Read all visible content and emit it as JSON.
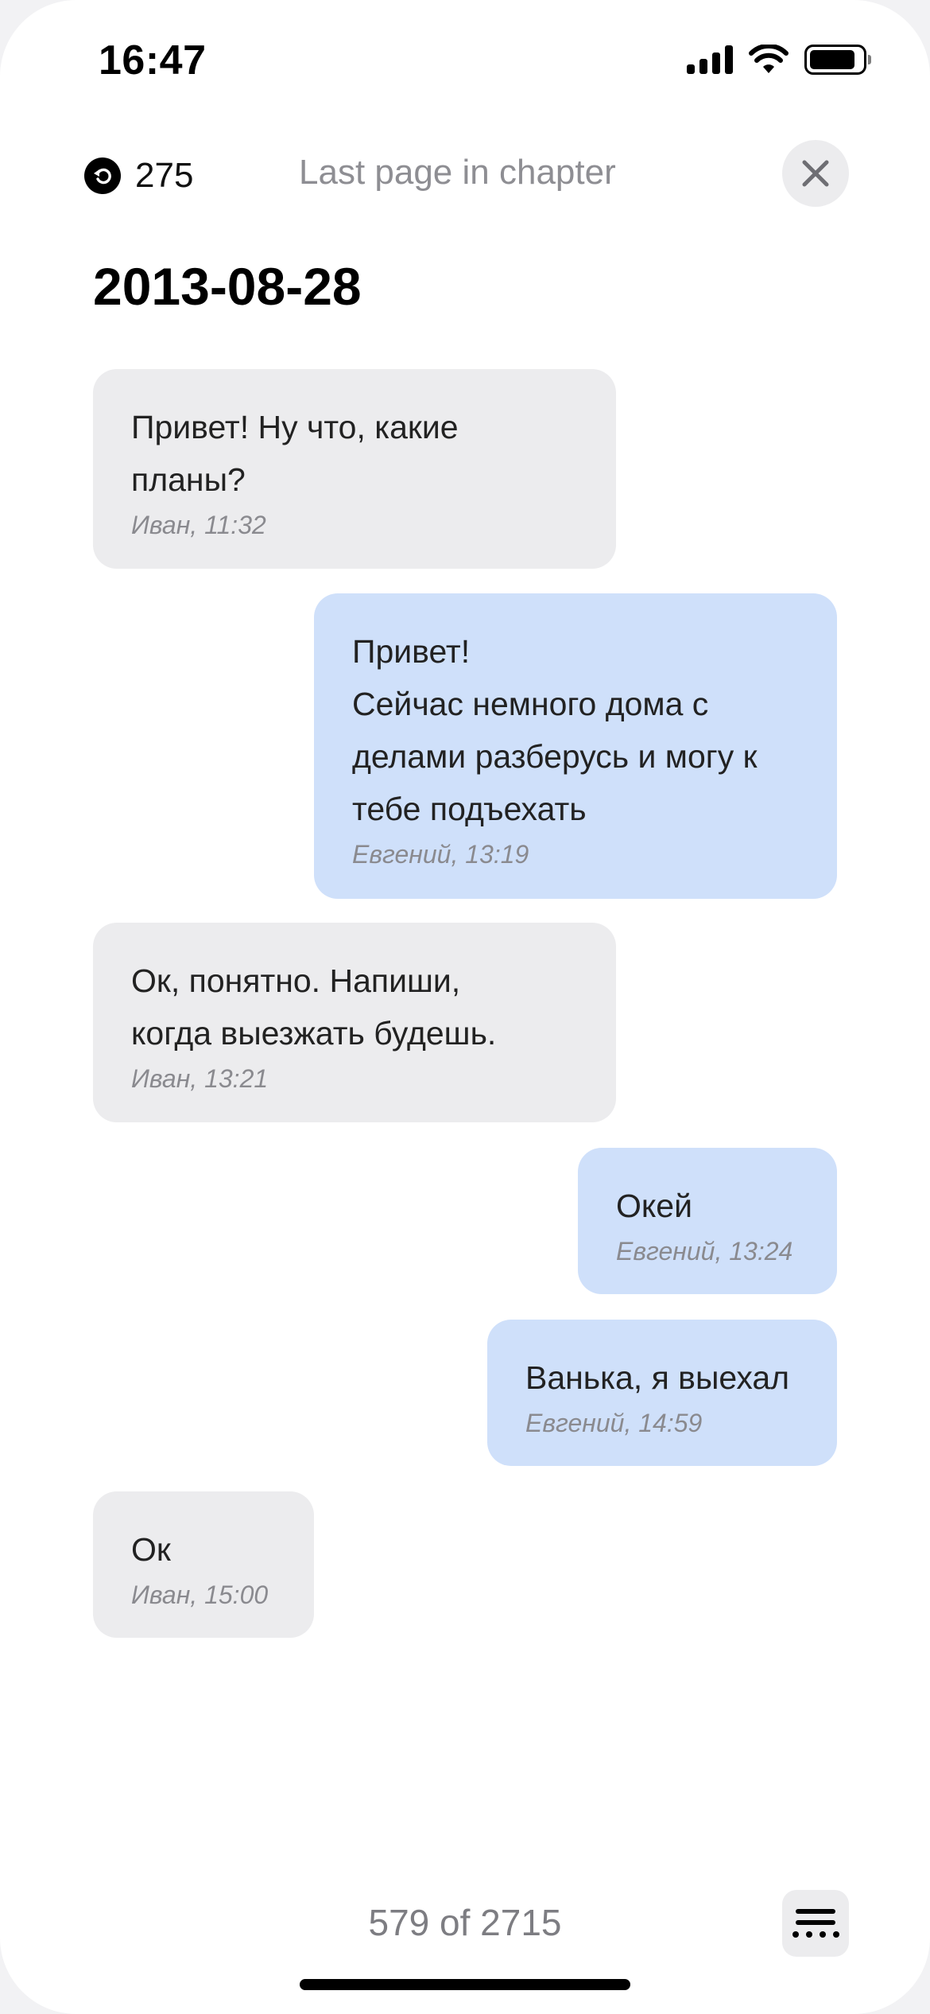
{
  "status_bar": {
    "time": "16:47"
  },
  "header": {
    "back_count": "275",
    "title": "Last page in chapter"
  },
  "date_heading": "2013-08-28",
  "messages": [
    {
      "direction": "in",
      "text": "Привет! Ну что, какие\nпланы?",
      "meta": "Иван, 11:32"
    },
    {
      "direction": "out",
      "text": "Привет!\nСейчас немного дома с\nделами разберусь и могу к\nтебе подъехать",
      "meta": "Евгений, 13:19"
    },
    {
      "direction": "in",
      "text": "Ок, понятно. Напиши,\nкогда выезжать будешь.",
      "meta": "Иван, 13:21"
    },
    {
      "direction": "out",
      "text": "Окей",
      "meta": "Евгений, 13:24"
    },
    {
      "direction": "out",
      "text": "Ванька, я выехал",
      "meta": "Евгений, 14:59"
    },
    {
      "direction": "in",
      "text": "Ок",
      "meta": "Иван, 15:00"
    }
  ],
  "footer": {
    "page_counter": "579 of 2715"
  },
  "colors": {
    "incoming_bubble": "#ececee",
    "outgoing_bubble": "#cfe0fa"
  },
  "icons": {
    "back": "back-arrow-circle-icon",
    "close": "close-icon",
    "menu": "menu-icon"
  }
}
